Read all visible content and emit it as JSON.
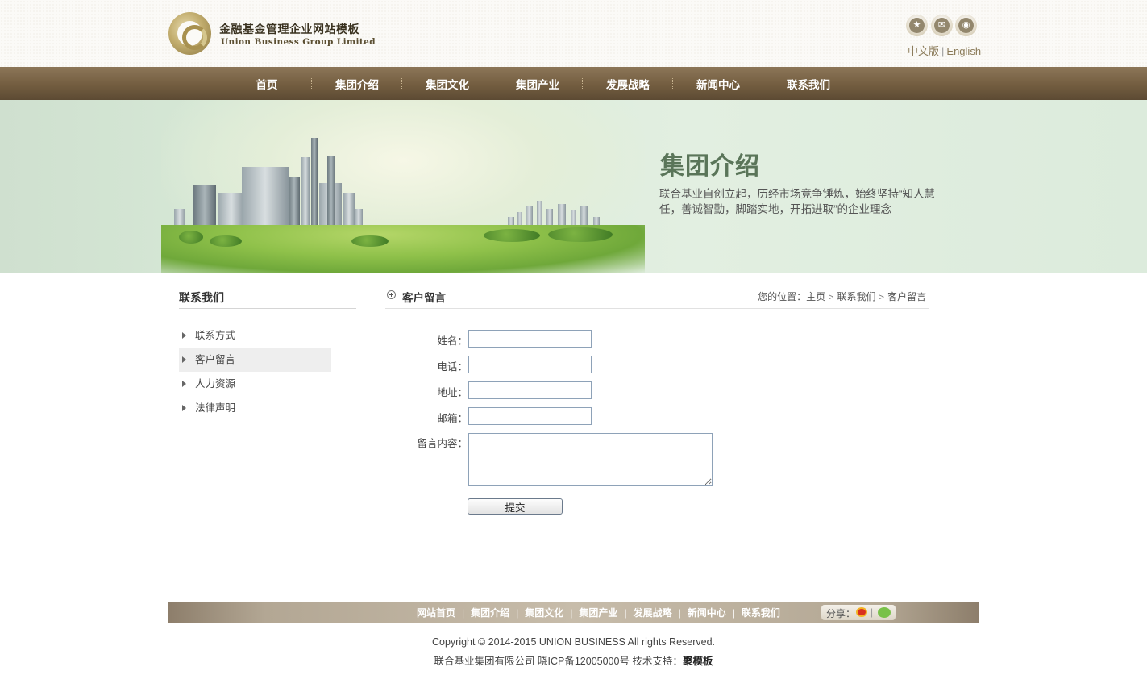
{
  "logo": {
    "cn": "金融基金管理企业网站模板",
    "en": "Union Business Group Limited"
  },
  "social": {
    "icons": [
      "star-icon",
      "mail-icon",
      "weibo-icon"
    ]
  },
  "lang": {
    "cn": "中文版",
    "sep": "|",
    "en": "English"
  },
  "nav": {
    "items": [
      "首页",
      "集团介绍",
      "集团文化",
      "集团产业",
      "发展战略",
      "新闻中心",
      "联系我们"
    ]
  },
  "banner": {
    "title": "集团介绍",
    "text": "联合基业自创立起，历经市场竞争锤炼，始终坚持“知人慧任，善诚智勤，脚踏实地，开拓进取”的企业理念"
  },
  "sidebar": {
    "title": "联系我们",
    "items": [
      "联系方式",
      "客户留言",
      "人力资源",
      "法律声明"
    ],
    "active": "客户留言"
  },
  "main": {
    "title": "客户留言",
    "breadcrumb": {
      "prefix": "您的位置：",
      "items": [
        "主页",
        "联系我们",
        "客户留言"
      ],
      "arrow": ">"
    }
  },
  "form": {
    "name_label": "姓名：",
    "name_value": "",
    "phone_label": "电话：",
    "phone_value": "",
    "address_label": "地址：",
    "address_value": "",
    "email_label": "邮箱：",
    "email_value": "",
    "message_label": "留言内容：",
    "message_value": "",
    "submit_label": "提交"
  },
  "footer": {
    "links": [
      "网站首页",
      "集团介绍",
      "集团文化",
      "集团产业",
      "发展战略",
      "新闻中心",
      "联系我们"
    ],
    "share_label": "分享：",
    "share_sep": "|",
    "copyright": "Copyright © 2014-2015 UNION BUSINESS All rights Reserved.",
    "icp": "联合基业集团有限公司 晓ICP备12005000号  技术支持：",
    "tech": "聚模板"
  }
}
